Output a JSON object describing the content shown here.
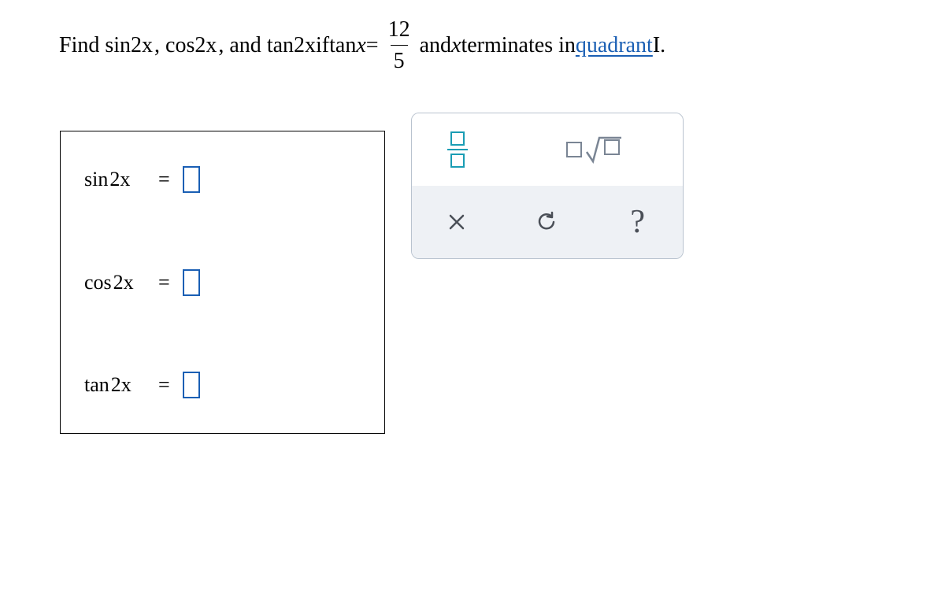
{
  "question": {
    "prefix": "Find ",
    "f1": "sin",
    "arg1": "2x",
    "sep1": ", ",
    "f2": "cos",
    "arg2": "2x",
    "sep2": ", and ",
    "f3": "tan",
    "arg3": "2x",
    "mid": " if ",
    "f4": "tan",
    "arg4": "x",
    "eq": " = ",
    "frac_num": "12",
    "frac_den": "5",
    "after": " and ",
    "var": "x",
    "after2": " terminates in ",
    "link": "quadrant",
    "tail": " I."
  },
  "answers": {
    "r1_func": "sin",
    "r1_arg": "2x",
    "r2_func": "cos",
    "r2_arg": "2x",
    "r3_func": "tan",
    "r3_arg": "2x",
    "eq": "="
  },
  "palette": {
    "fraction_tool": "fraction",
    "sqrt_tool": "square-root",
    "clear": "×",
    "reset": "↺",
    "help": "?"
  }
}
